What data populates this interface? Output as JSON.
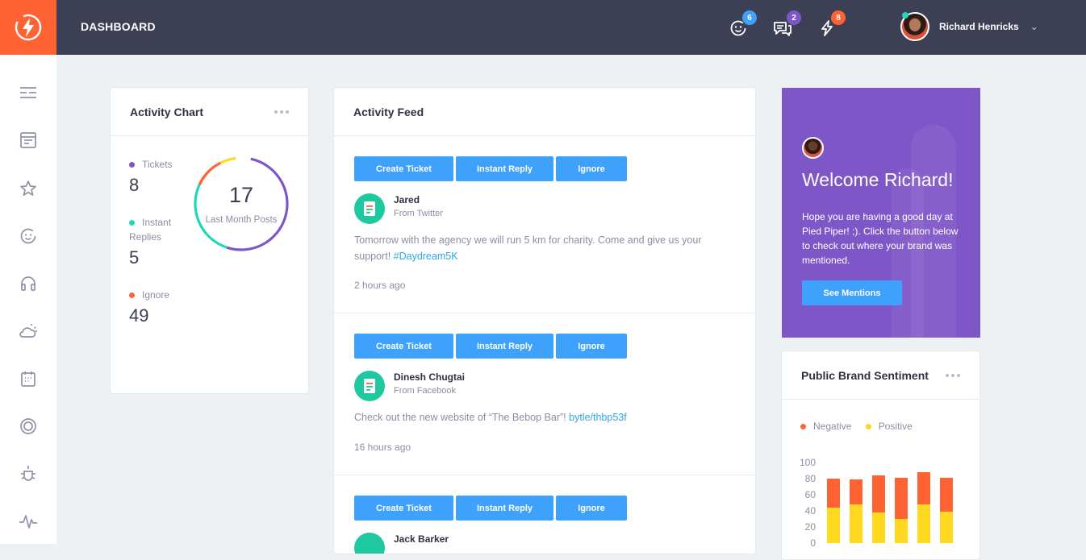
{
  "header": {
    "title": "DASHBOARD",
    "notifications": [
      {
        "icon": "smiley-icon",
        "count": "6",
        "color": "#3ea2fc"
      },
      {
        "icon": "chat-icon",
        "count": "2",
        "color": "#7f56c8"
      },
      {
        "icon": "bolt-icon",
        "count": "8",
        "color": "#ff6233"
      }
    ],
    "user_name": "Richard Henricks"
  },
  "sidebar": {
    "items": [
      "menu-icon",
      "inbox-icon",
      "star-icon",
      "smiley-icon",
      "headset-icon",
      "weather-icon",
      "calendar-icon",
      "target-icon",
      "bug-icon",
      "pulse-icon"
    ]
  },
  "activity_chart": {
    "title": "Activity Chart",
    "stats": [
      {
        "label": "Tickets",
        "value": "8",
        "color": "#7f56c8"
      },
      {
        "label": "Instant Replies",
        "value": "5",
        "color": "#1fd8b8"
      },
      {
        "label": "Ignore",
        "value": "49",
        "color": "#ff6233"
      }
    ],
    "ring_value": "17",
    "ring_label": "Last Month Posts"
  },
  "activity_feed": {
    "title": "Activity Feed",
    "buttons": {
      "create": "Create Ticket",
      "reply": "Instant Reply",
      "ignore": "Ignore"
    },
    "items": [
      {
        "name": "Jared",
        "source": "From Twitter",
        "text": "Tomorrow with the agency we will run 5 km for charity. Come and give us your support! ",
        "link": "#Daydream5K",
        "time": "2 hours ago"
      },
      {
        "name": "Dinesh Chugtai",
        "source": "From Facebook",
        "text": "Check out the new website of “The Bebop Bar”! ",
        "link": "bytle/thbp53f",
        "time": "16 hours ago"
      },
      {
        "name": "Jack Barker",
        "source": "",
        "text": "",
        "link": "",
        "time": ""
      }
    ]
  },
  "welcome": {
    "title": "Welcome Richard!",
    "text": "Hope you are having a good day at Pied Piper! ;). Click the button below to check out where your brand was mentioned.",
    "button": "See Mentions"
  },
  "sentiment": {
    "title": "Public Brand Sentiment",
    "colors": {
      "negative": "#ff6233",
      "positive": "#ffd81f"
    }
  },
  "chart_data": {
    "type": "bar",
    "title": "",
    "xlabel": "",
    "ylabel": "",
    "ylim": [
      0,
      100
    ],
    "yticks": [
      "100",
      "80",
      "60",
      "40",
      "20",
      "0"
    ],
    "stacked": true,
    "series": [
      {
        "name": "Negative",
        "values": [
          36,
          31,
          46,
          51,
          40,
          42
        ],
        "color": "#ff6233"
      },
      {
        "name": "Positive",
        "values": [
          44,
          48,
          38,
          30,
          48,
          39
        ],
        "color": "#ffd81f"
      }
    ]
  }
}
